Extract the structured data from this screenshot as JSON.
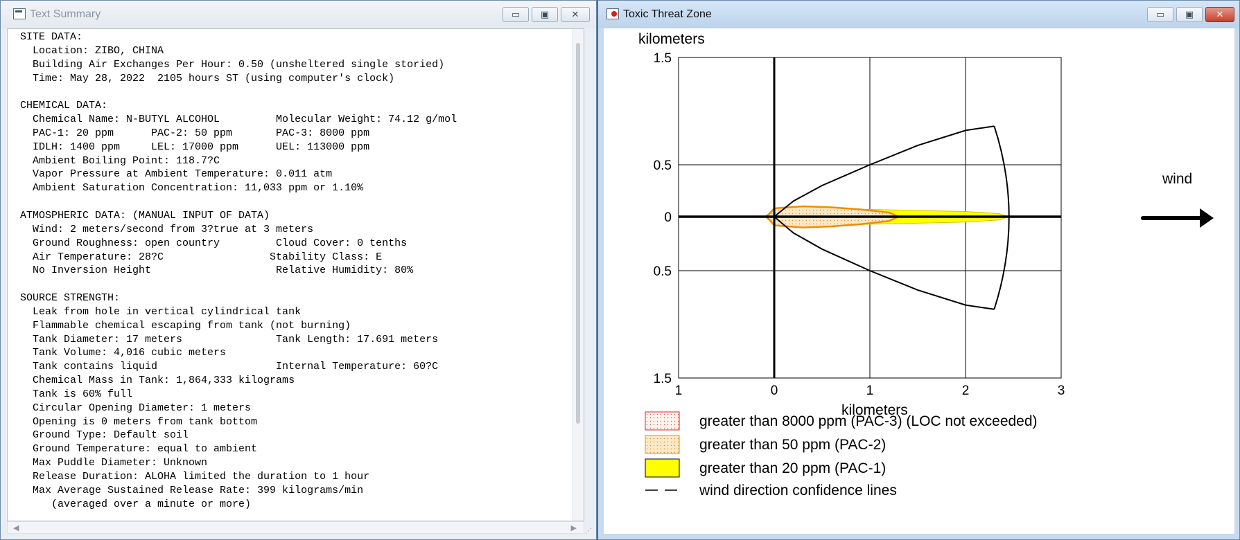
{
  "text_window": {
    "title": "Text Summary",
    "controls": {
      "minimize": "▭",
      "maximize": "▣",
      "close": "✕"
    },
    "lines": [
      "SITE DATA:",
      "  Location: ZIBO, CHINA",
      "  Building Air Exchanges Per Hour: 0.50 (unsheltered single storied)",
      "  Time: May 28, 2022  2105 hours ST (using computer's clock)",
      "",
      "CHEMICAL DATA:",
      "  Chemical Name: N-BUTYL ALCOHOL         Molecular Weight: 74.12 g/mol",
      "  PAC-1: 20 ppm      PAC-2: 50 ppm       PAC-3: 8000 ppm",
      "  IDLH: 1400 ppm     LEL: 17000 ppm      UEL: 113000 ppm",
      "  Ambient Boiling Point: 118.7?C",
      "  Vapor Pressure at Ambient Temperature: 0.011 atm",
      "  Ambient Saturation Concentration: 11,033 ppm or 1.10%",
      "",
      "ATMOSPHERIC DATA: (MANUAL INPUT OF DATA)",
      "  Wind: 2 meters/second from 3?true at 3 meters",
      "  Ground Roughness: open country         Cloud Cover: 0 tenths",
      "  Air Temperature: 28?C                 Stability Class: E",
      "  No Inversion Height                    Relative Humidity: 80%",
      "",
      "SOURCE STRENGTH:",
      "  Leak from hole in vertical cylindrical tank",
      "  Flammable chemical escaping from tank (not burning)",
      "  Tank Diameter: 17 meters               Tank Length: 17.691 meters",
      "  Tank Volume: 4,016 cubic meters",
      "  Tank contains liquid                   Internal Temperature: 60?C",
      "  Chemical Mass in Tank: 1,864,333 kilograms",
      "  Tank is 60% full",
      "  Circular Opening Diameter: 1 meters",
      "  Opening is 0 meters from tank bottom",
      "  Ground Type: Default soil",
      "  Ground Temperature: equal to ambient",
      "  Max Puddle Diameter: Unknown",
      "  Release Duration: ALOHA limited the duration to 1 hour",
      "  Max Average Sustained Release Rate: 399 kilograms/min",
      "     (averaged over a minute or more)"
    ]
  },
  "threat_window": {
    "title": "Toxic Threat Zone",
    "controls": {
      "minimize": "▭",
      "maximize": "▣",
      "close": "✕"
    },
    "wind_label": "wind",
    "legend": [
      {
        "label": "greater than 8000 ppm (PAC-3) (LOC not exceeded)",
        "style": "pac3"
      },
      {
        "label": "greater than 50 ppm (PAC-2)",
        "style": "pac2"
      },
      {
        "label": "greater than 20 ppm (PAC-1)",
        "style": "pac1"
      },
      {
        "label": "wind direction confidence lines",
        "style": "dash"
      }
    ]
  },
  "chart_data": {
    "type": "area",
    "title": "",
    "xlabel": "kilometers",
    "ylabel": "kilometers",
    "xlim": [
      -1,
      3
    ],
    "ylim": [
      -1.5,
      1.5
    ],
    "x_tick_values": [
      -1,
      0,
      1,
      2,
      3
    ],
    "x_tick_labels": [
      "1",
      "0",
      "1",
      "2",
      "3"
    ],
    "y_tick_values": [
      1.5,
      0.5,
      0,
      -0.5,
      -1.5
    ],
    "y_tick_labels": [
      "1.5",
      "0.5",
      "0",
      "0.5",
      "1.5"
    ],
    "grid": true,
    "colors": {
      "pac1": "#ffff00",
      "pac2_outline": "#f08c00",
      "pac2_fill": "#fde9c8",
      "pac3_outline": "#e02020",
      "confidence": "#000000"
    },
    "series": [
      {
        "name": "greater than 20 ppm (PAC-1)",
        "x": [
          -0.1,
          0.0,
          0.5,
          1.0,
          1.5,
          2.0,
          2.35,
          2.45
        ],
        "y_half_width": [
          0.0,
          0.07,
          0.08,
          0.07,
          0.06,
          0.05,
          0.03,
          0.0
        ]
      },
      {
        "name": "greater than 50 ppm (PAC-2)",
        "x": [
          -0.08,
          0.0,
          0.3,
          0.6,
          0.9,
          1.2,
          1.3
        ],
        "y_half_width": [
          0.0,
          0.08,
          0.1,
          0.09,
          0.07,
          0.04,
          0.0
        ]
      },
      {
        "name": "wind direction confidence lines",
        "x": [
          0.0,
          0.2,
          0.5,
          1.0,
          1.5,
          2.0,
          2.3
        ],
        "y_upper": [
          0.0,
          0.15,
          0.3,
          0.5,
          0.68,
          0.82,
          0.86
        ],
        "y_lower": [
          0.0,
          -0.15,
          -0.3,
          -0.5,
          -0.68,
          -0.82,
          -0.86
        ],
        "arc_end_x": 2.45
      }
    ]
  }
}
